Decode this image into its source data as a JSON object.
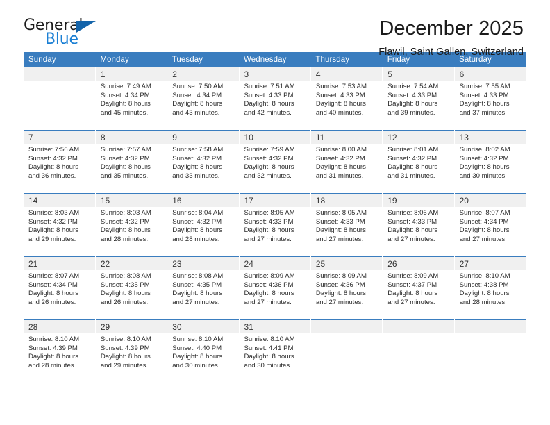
{
  "logo": {
    "text_dark": "General",
    "text_blue": "Blue",
    "triangle": "triangle-icon",
    "brand_blue": "#1a7fd4",
    "triangle_color": "#1464aa"
  },
  "header": {
    "title": "December 2025",
    "subtitle": "Flawil, Saint Gallen, Switzerland"
  },
  "calendar": {
    "header_color": "#3a7dbf",
    "weekdays": [
      "Sunday",
      "Monday",
      "Tuesday",
      "Wednesday",
      "Thursday",
      "Friday",
      "Saturday"
    ],
    "weeks": [
      [
        {
          "day": "",
          "lines": []
        },
        {
          "day": "1",
          "lines": [
            "Sunrise: 7:49 AM",
            "Sunset: 4:34 PM",
            "Daylight: 8 hours",
            "and 45 minutes."
          ]
        },
        {
          "day": "2",
          "lines": [
            "Sunrise: 7:50 AM",
            "Sunset: 4:34 PM",
            "Daylight: 8 hours",
            "and 43 minutes."
          ]
        },
        {
          "day": "3",
          "lines": [
            "Sunrise: 7:51 AM",
            "Sunset: 4:33 PM",
            "Daylight: 8 hours",
            "and 42 minutes."
          ]
        },
        {
          "day": "4",
          "lines": [
            "Sunrise: 7:53 AM",
            "Sunset: 4:33 PM",
            "Daylight: 8 hours",
            "and 40 minutes."
          ]
        },
        {
          "day": "5",
          "lines": [
            "Sunrise: 7:54 AM",
            "Sunset: 4:33 PM",
            "Daylight: 8 hours",
            "and 39 minutes."
          ]
        },
        {
          "day": "6",
          "lines": [
            "Sunrise: 7:55 AM",
            "Sunset: 4:33 PM",
            "Daylight: 8 hours",
            "and 37 minutes."
          ]
        }
      ],
      [
        {
          "day": "7",
          "lines": [
            "Sunrise: 7:56 AM",
            "Sunset: 4:32 PM",
            "Daylight: 8 hours",
            "and 36 minutes."
          ]
        },
        {
          "day": "8",
          "lines": [
            "Sunrise: 7:57 AM",
            "Sunset: 4:32 PM",
            "Daylight: 8 hours",
            "and 35 minutes."
          ]
        },
        {
          "day": "9",
          "lines": [
            "Sunrise: 7:58 AM",
            "Sunset: 4:32 PM",
            "Daylight: 8 hours",
            "and 33 minutes."
          ]
        },
        {
          "day": "10",
          "lines": [
            "Sunrise: 7:59 AM",
            "Sunset: 4:32 PM",
            "Daylight: 8 hours",
            "and 32 minutes."
          ]
        },
        {
          "day": "11",
          "lines": [
            "Sunrise: 8:00 AM",
            "Sunset: 4:32 PM",
            "Daylight: 8 hours",
            "and 31 minutes."
          ]
        },
        {
          "day": "12",
          "lines": [
            "Sunrise: 8:01 AM",
            "Sunset: 4:32 PM",
            "Daylight: 8 hours",
            "and 31 minutes."
          ]
        },
        {
          "day": "13",
          "lines": [
            "Sunrise: 8:02 AM",
            "Sunset: 4:32 PM",
            "Daylight: 8 hours",
            "and 30 minutes."
          ]
        }
      ],
      [
        {
          "day": "14",
          "lines": [
            "Sunrise: 8:03 AM",
            "Sunset: 4:32 PM",
            "Daylight: 8 hours",
            "and 29 minutes."
          ]
        },
        {
          "day": "15",
          "lines": [
            "Sunrise: 8:03 AM",
            "Sunset: 4:32 PM",
            "Daylight: 8 hours",
            "and 28 minutes."
          ]
        },
        {
          "day": "16",
          "lines": [
            "Sunrise: 8:04 AM",
            "Sunset: 4:32 PM",
            "Daylight: 8 hours",
            "and 28 minutes."
          ]
        },
        {
          "day": "17",
          "lines": [
            "Sunrise: 8:05 AM",
            "Sunset: 4:33 PM",
            "Daylight: 8 hours",
            "and 27 minutes."
          ]
        },
        {
          "day": "18",
          "lines": [
            "Sunrise: 8:05 AM",
            "Sunset: 4:33 PM",
            "Daylight: 8 hours",
            "and 27 minutes."
          ]
        },
        {
          "day": "19",
          "lines": [
            "Sunrise: 8:06 AM",
            "Sunset: 4:33 PM",
            "Daylight: 8 hours",
            "and 27 minutes."
          ]
        },
        {
          "day": "20",
          "lines": [
            "Sunrise: 8:07 AM",
            "Sunset: 4:34 PM",
            "Daylight: 8 hours",
            "and 27 minutes."
          ]
        }
      ],
      [
        {
          "day": "21",
          "lines": [
            "Sunrise: 8:07 AM",
            "Sunset: 4:34 PM",
            "Daylight: 8 hours",
            "and 26 minutes."
          ]
        },
        {
          "day": "22",
          "lines": [
            "Sunrise: 8:08 AM",
            "Sunset: 4:35 PM",
            "Daylight: 8 hours",
            "and 26 minutes."
          ]
        },
        {
          "day": "23",
          "lines": [
            "Sunrise: 8:08 AM",
            "Sunset: 4:35 PM",
            "Daylight: 8 hours",
            "and 27 minutes."
          ]
        },
        {
          "day": "24",
          "lines": [
            "Sunrise: 8:09 AM",
            "Sunset: 4:36 PM",
            "Daylight: 8 hours",
            "and 27 minutes."
          ]
        },
        {
          "day": "25",
          "lines": [
            "Sunrise: 8:09 AM",
            "Sunset: 4:36 PM",
            "Daylight: 8 hours",
            "and 27 minutes."
          ]
        },
        {
          "day": "26",
          "lines": [
            "Sunrise: 8:09 AM",
            "Sunset: 4:37 PM",
            "Daylight: 8 hours",
            "and 27 minutes."
          ]
        },
        {
          "day": "27",
          "lines": [
            "Sunrise: 8:10 AM",
            "Sunset: 4:38 PM",
            "Daylight: 8 hours",
            "and 28 minutes."
          ]
        }
      ],
      [
        {
          "day": "28",
          "lines": [
            "Sunrise: 8:10 AM",
            "Sunset: 4:39 PM",
            "Daylight: 8 hours",
            "and 28 minutes."
          ]
        },
        {
          "day": "29",
          "lines": [
            "Sunrise: 8:10 AM",
            "Sunset: 4:39 PM",
            "Daylight: 8 hours",
            "and 29 minutes."
          ]
        },
        {
          "day": "30",
          "lines": [
            "Sunrise: 8:10 AM",
            "Sunset: 4:40 PM",
            "Daylight: 8 hours",
            "and 30 minutes."
          ]
        },
        {
          "day": "31",
          "lines": [
            "Sunrise: 8:10 AM",
            "Sunset: 4:41 PM",
            "Daylight: 8 hours",
            "and 30 minutes."
          ]
        },
        {
          "day": "",
          "lines": []
        },
        {
          "day": "",
          "lines": []
        },
        {
          "day": "",
          "lines": []
        }
      ]
    ]
  }
}
